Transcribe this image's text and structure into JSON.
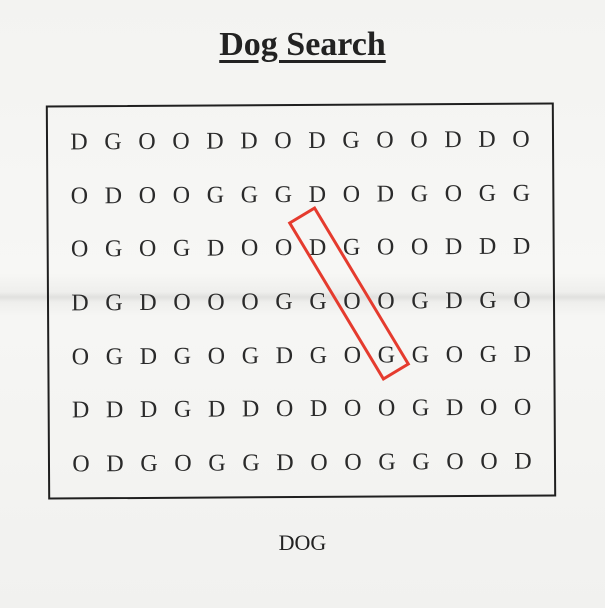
{
  "title": "Dog Search",
  "word_list": [
    "DOG"
  ],
  "grid": [
    [
      "D",
      "G",
      "O",
      "O",
      "D",
      "D",
      "O",
      "D",
      "G",
      "O",
      "O",
      "D",
      "D",
      "O"
    ],
    [
      "O",
      "D",
      "O",
      "O",
      "G",
      "G",
      "G",
      "D",
      "O",
      "D",
      "G",
      "O",
      "G",
      "G"
    ],
    [
      "O",
      "G",
      "O",
      "G",
      "D",
      "O",
      "O",
      "D",
      "G",
      "O",
      "O",
      "D",
      "D",
      "D"
    ],
    [
      "D",
      "G",
      "D",
      "O",
      "O",
      "O",
      "G",
      "G",
      "O",
      "O",
      "G",
      "D",
      "G",
      "O"
    ],
    [
      "O",
      "G",
      "D",
      "G",
      "O",
      "G",
      "D",
      "G",
      "O",
      "G",
      "G",
      "O",
      "G",
      "D"
    ],
    [
      "D",
      "D",
      "D",
      "G",
      "D",
      "D",
      "O",
      "D",
      "O",
      "O",
      "G",
      "D",
      "O",
      "O"
    ],
    [
      "O",
      "D",
      "G",
      "O",
      "G",
      "G",
      "D",
      "O",
      "O",
      "G",
      "G",
      "O",
      "O",
      "D"
    ]
  ],
  "highlight_color": "#e53b2e"
}
